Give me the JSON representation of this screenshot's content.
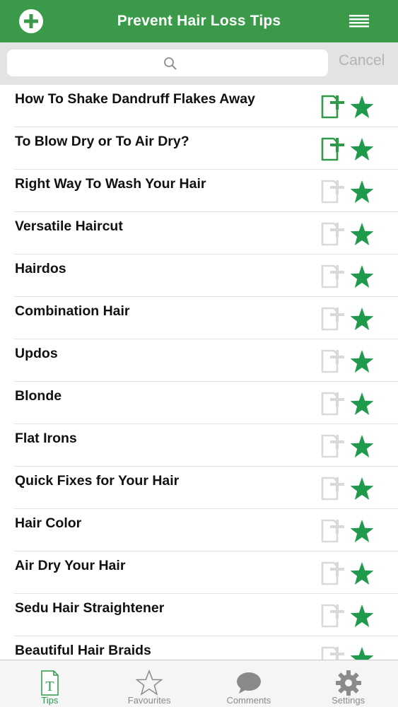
{
  "navbar": {
    "title": "Prevent Hair Loss Tips",
    "add_icon": "plus-circle-icon",
    "menu_icon": "hamburger-menu-icon",
    "bg_color": "#3a9a4a"
  },
  "search": {
    "placeholder": "",
    "value": "",
    "cancel_label": "Cancel"
  },
  "tips": [
    {
      "title": "How To Shake Dandruff Flakes Away",
      "added": true
    },
    {
      "title": "To Blow Dry or To Air Dry?",
      "added": true
    },
    {
      "title": "Right Way To Wash Your Hair",
      "added": false
    },
    {
      "title": "Versatile Haircut",
      "added": false
    },
    {
      "title": "Hairdos",
      "added": false
    },
    {
      "title": "Combination Hair",
      "added": false
    },
    {
      "title": "Updos",
      "added": false
    },
    {
      "title": "Blonde",
      "added": false
    },
    {
      "title": "Flat Irons",
      "added": false
    },
    {
      "title": "Quick Fixes for Your Hair",
      "added": false
    },
    {
      "title": "Hair Color",
      "added": false
    },
    {
      "title": "Air Dry Your Hair",
      "added": false
    },
    {
      "title": "Sedu Hair Straightener",
      "added": false
    },
    {
      "title": "Beautiful Hair Braids",
      "added": false
    }
  ],
  "colors": {
    "accent": "#2e9a4a",
    "star": "#1f9a4c",
    "inactive_icon": "#d9d9d9"
  },
  "tabbar": {
    "tabs": [
      {
        "label": "Tips",
        "icon": "document-t-icon",
        "active": true
      },
      {
        "label": "Favourites",
        "icon": "star-outline-icon",
        "active": false
      },
      {
        "label": "Comments",
        "icon": "speech-bubble-icon",
        "active": false
      },
      {
        "label": "Settings",
        "icon": "gear-icon",
        "active": false
      }
    ]
  }
}
